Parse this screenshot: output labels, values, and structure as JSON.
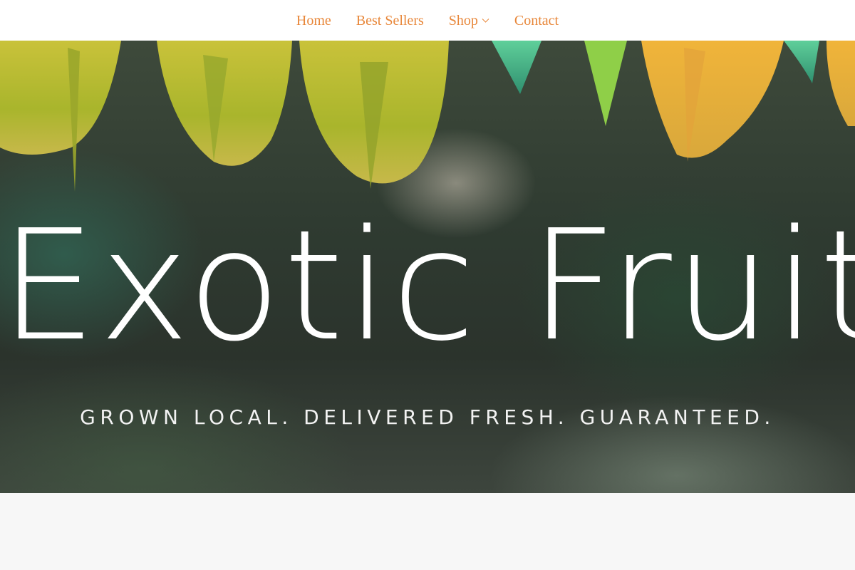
{
  "nav": {
    "items": [
      {
        "label": "Home"
      },
      {
        "label": "Best Sellers"
      },
      {
        "label": "Shop",
        "icon": "chevron-down-icon"
      },
      {
        "label": "Contact"
      }
    ],
    "link_color": "#e8873a"
  },
  "hero": {
    "title": "Exotic Fruit",
    "tagline": "GROWN LOCAL. DELIVERED FRESH. GUARANTEED.",
    "image": "star-fruit-on-branch"
  },
  "colors": {
    "accent": "#e8873a",
    "text_on_hero": "#ffffff",
    "page_background": "#f7f7f7"
  }
}
